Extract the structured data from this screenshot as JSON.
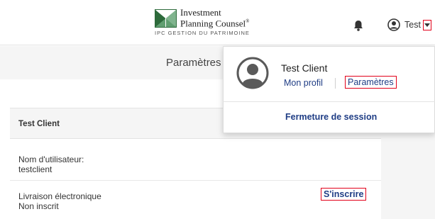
{
  "header": {
    "logo": {
      "line1": "Investment",
      "line2": "Planning Counsel",
      "mark": "®",
      "tagline": "IPC GESTION DU PATRIMOINE"
    },
    "notifications_icon": "bell-icon",
    "user": {
      "avatar_icon": "user-circle-icon",
      "name": "Test",
      "caret_icon": "caret-down-icon"
    }
  },
  "page": {
    "title": "Paramètres"
  },
  "account_card": {
    "header": "Test Client",
    "fields": [
      {
        "label": "Nom d'utilisateur:",
        "value": "testclient"
      },
      {
        "label": "Livraison électronique",
        "value": "Non inscrit"
      }
    ],
    "enroll_link": "S'inscrire"
  },
  "dropdown": {
    "avatar_icon": "user-avatar-icon",
    "name": "Test Client",
    "profile_link": "Mon profil",
    "settings_link": "Paramètres",
    "logout": "Fermeture de session"
  },
  "colors": {
    "link": "#1f3d85",
    "highlight_border": "#e2001a",
    "band_gray": "#f5f5f5",
    "logo_green": "#2d6a3b"
  }
}
